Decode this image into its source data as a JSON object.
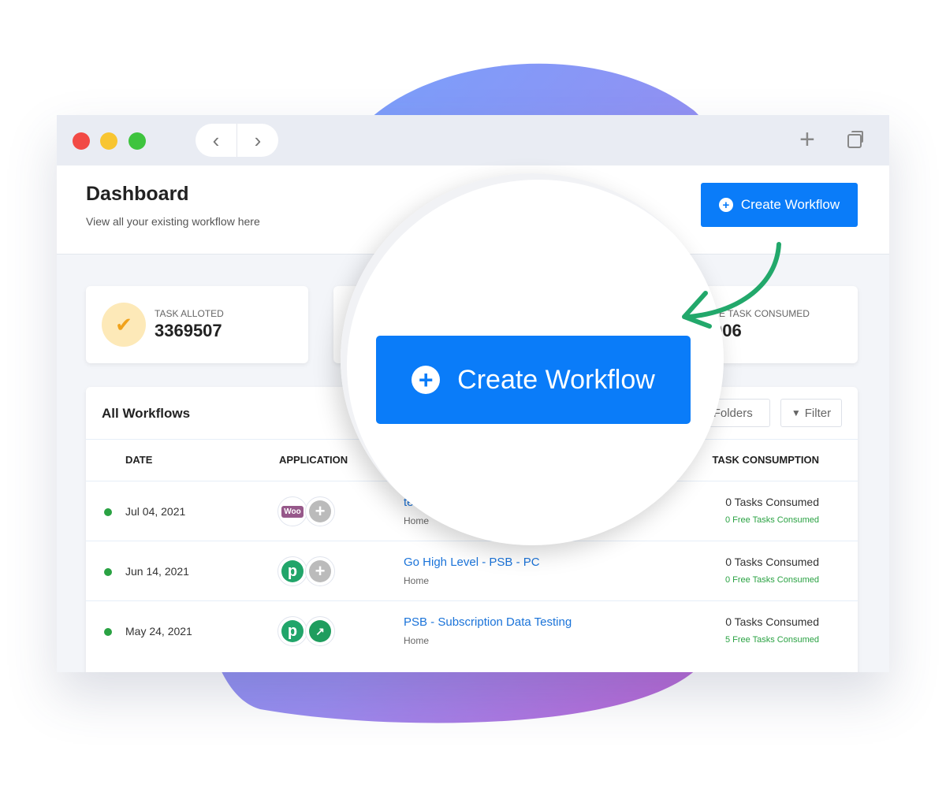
{
  "window": {
    "controls": [
      "close",
      "minimize",
      "maximize"
    ],
    "back_icon": "chevron-left-icon",
    "forward_icon": "chevron-right-icon",
    "new_tab_icon": "plus-icon",
    "copy_icon": "copy-icon"
  },
  "header": {
    "title": "Dashboard",
    "subtitle": "View all your existing workflow here",
    "create_button": "Create Workflow"
  },
  "stats": [
    {
      "label": "TASK ALLOTED",
      "value": "3369507",
      "icon": "badge-check-icon"
    },
    {
      "label": "EE TASK CONSUMED",
      "value": "006"
    }
  ],
  "magnifier": {
    "button": "Create Workflow"
  },
  "table": {
    "title": "All Workflows",
    "folders_label": "Folders",
    "filter_label": "Filter",
    "columns": [
      "DATE",
      "APPLICATION",
      "TASK CONSUMPTION"
    ],
    "rows": [
      {
        "date": "Jul 04, 2021",
        "apps": [
          "woocommerce",
          "add"
        ],
        "name": "te",
        "folder": "Home",
        "tasks": "0 Tasks Consumed",
        "free": "0 Free Tasks Consumed"
      },
      {
        "date": "Jun 14, 2021",
        "apps": [
          "pabbly",
          "add"
        ],
        "name": "Go High Level - PSB - PC",
        "folder": "Home",
        "tasks": "0 Tasks Consumed",
        "free": "0 Free Tasks Consumed"
      },
      {
        "date": "May 24, 2021",
        "apps": [
          "pabbly",
          "router"
        ],
        "name": "PSB - Subscription Data Testing",
        "folder": "Home",
        "tasks": "0 Tasks Consumed",
        "free": "5 Free Tasks Consumed"
      }
    ]
  },
  "colors": {
    "accent": "#0a7cf9",
    "success": "#2aa243",
    "arrow": "#22a86b"
  }
}
